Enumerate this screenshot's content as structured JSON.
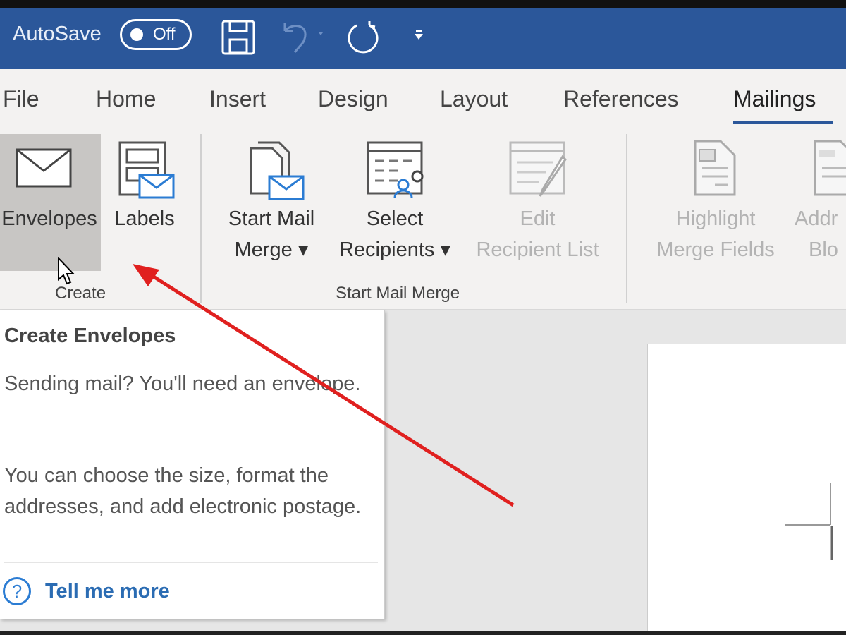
{
  "titlebar": {
    "autosave_label": "AutoSave",
    "autosave_state": "Off"
  },
  "tabs": [
    "File",
    "Home",
    "Insert",
    "Design",
    "Layout",
    "References",
    "Mailings"
  ],
  "active_tab": "Mailings",
  "ribbon": {
    "envelopes": "Envelopes",
    "labels": "Labels",
    "create_group": "Create",
    "start_mail_merge_1": "Start Mail",
    "start_mail_merge_2": "Merge ▾",
    "select_recipients_1": "Select",
    "select_recipients_2": "Recipients ▾",
    "edit_list_1": "Edit",
    "edit_list_2": "Recipient List",
    "smm_group": "Start Mail Merge",
    "highlight_1": "Highlight",
    "highlight_2": "Merge Fields",
    "address_1": "Addr",
    "address_2": "Blo"
  },
  "tooltip": {
    "title": "Create Envelopes",
    "p1": "Sending mail? You'll need an envelope.",
    "p2": "You can choose the size, format the addresses, and add electronic postage.",
    "help_icon": "?",
    "tell_me_more": "Tell me more"
  },
  "colors": {
    "titlebar": "#2b579a",
    "arrow": "#e0201f",
    "link": "#2b6cb3"
  }
}
